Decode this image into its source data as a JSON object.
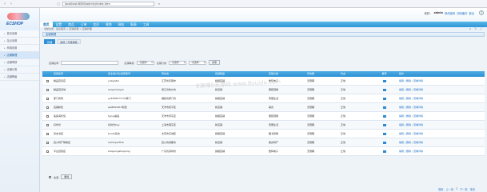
{
  "browser": {
    "url": "localhost:8080/admin/index.htm"
  },
  "logo": {
    "text": "ECSHOP"
  },
  "header": {
    "menu": [
      "首页",
      "设置",
      "商品",
      "订单",
      "会员",
      "营销",
      "网站",
      "报表",
      "工具"
    ],
    "active_index": 0,
    "user_label": "你好：",
    "user_name": "admin",
    "links": [
      "修改密码",
      "清除缓存",
      "退出"
    ]
  },
  "breadcrumb": {
    "text": "当前位置：后台首页 > 店铺管理 > 店铺管理"
  },
  "sidebar": {
    "items": [
      "首页设置",
      "站点设置",
      "商城设置",
      "店铺管理",
      "店铺审核",
      "店铺分类",
      "店铺等级"
    ],
    "active_index": 3
  },
  "panel": {
    "title": "店铺管理"
  },
  "tabs": [
    "管理",
    "新增 / 升级审核"
  ],
  "filters": {
    "store_name_label": "店铺名称",
    "store_level_label": "店铺等级",
    "store_level_value": "--请选择--",
    "store_class_label": "店铺分类",
    "store_class_value": "--请选择--",
    "store_status_value": "--请选择--",
    "search_button": "搜索"
  },
  "table": {
    "headers": [
      "",
      "店铺名称",
      "店主用户名/卖家账号",
      "所在地",
      "店铺等级",
      "店铺分类",
      "有效期",
      "状态",
      "推荐",
      "操作"
    ],
    "rows": [
      {
        "name": "精品百货店",
        "owner": "yukejafer",
        "region": "江苏省无锡市",
        "level": "旗舰店铺",
        "class": "数码电子",
        "expiry": "无限期",
        "status": "正常"
      },
      {
        "name": "精品百货城",
        "owner": "haiyanhaiyan",
        "region": "浙江省杭州市",
        "level": "新店铺",
        "class": "服装鞋帽",
        "expiry": "无限期",
        "status": "正常"
      },
      {
        "name": "厦门商场",
        "owner": "yy2638077731厦门",
        "region": "福建省厦门市",
        "level": "旗舰店铺",
        "class": "家居生活",
        "expiry": "无限期",
        "status": "正常"
      },
      {
        "name": "店铺新建",
        "owner": "wp8994413新建",
        "region": "天津市和平区",
        "level": "新店铺",
        "class": "美食",
        "expiry": "无限期",
        "status": "正常"
      },
      {
        "name": "鱼鱼海外馆",
        "owner": "fyyug鱼鱼",
        "region": "天津市河东区",
        "level": "旗舰店铺",
        "class": "服装鞋帽",
        "expiry": "无限期",
        "status": "正常"
      },
      {
        "name": "好时光",
        "owner": "好时光bay",
        "region": "上海市浦东区",
        "level": "新店铺",
        "class": "家居生活",
        "expiry": "无限期",
        "status": "正常"
      },
      {
        "name": "杂志书店",
        "owner": "books杂志",
        "region": "北京市东城区",
        "level": "旗舰店铺",
        "class": "图书音像",
        "expiry": "无限期",
        "status": "正常"
      },
      {
        "name": "四川特产购物店",
        "owner": "adminjiarfinb",
        "region": "四川省成都市",
        "level": "新店铺",
        "class": "美食特产",
        "expiry": "无限期",
        "status": "正常"
      },
      {
        "name": "平台自营店",
        "owner": "shoppingshopping",
        "region": "广东省深圳市",
        "level": "旗舰店铺",
        "class": "数码电子",
        "expiry": "无限期",
        "status": "正常"
      }
    ],
    "ops": [
      "编辑",
      "删除",
      "查看详情"
    ]
  },
  "footer": {
    "select_all_label": "全选",
    "delete_button": "删除"
  },
  "pager": {
    "first": "首页",
    "prev": "上一页",
    "current": "1",
    "next": "下一页",
    "last": "末页"
  },
  "watermark": {
    "text": "8演魂5无源码 www.8uuida.com"
  },
  "colors": {
    "menu": "#2d95d6",
    "accent": "#1c6fc9"
  }
}
